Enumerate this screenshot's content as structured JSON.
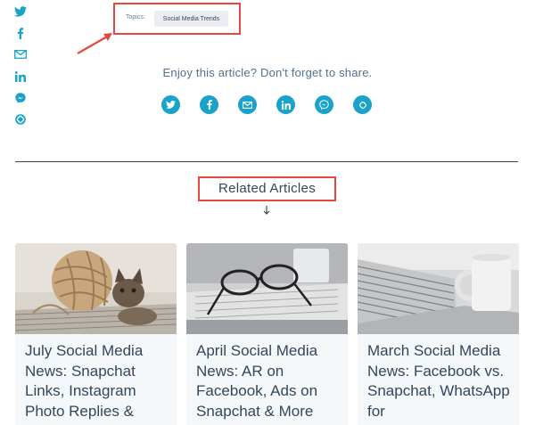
{
  "topics": {
    "label": "Topics:",
    "tag": "Social Media Trends"
  },
  "share": {
    "prompt": "Enjoy this article? Don't forget to share."
  },
  "social_icons": [
    "twitter-icon",
    "facebook-icon",
    "email-icon",
    "linkedin-icon",
    "messenger-icon",
    "share-link-icon"
  ],
  "related": {
    "title": "Related Articles",
    "articles": [
      {
        "title": "July Social Media News: Snapchat Links, Instagram Photo Replies &"
      },
      {
        "title": "April Social Media News: AR on Facebook, Ads on Snapchat & More"
      },
      {
        "title": "March Social Media News: Facebook vs. Snapchat, WhatsApp for"
      }
    ]
  },
  "colors": {
    "accent": "#1aa3c9",
    "highlight": "#e8473f",
    "text": "#33475b"
  }
}
